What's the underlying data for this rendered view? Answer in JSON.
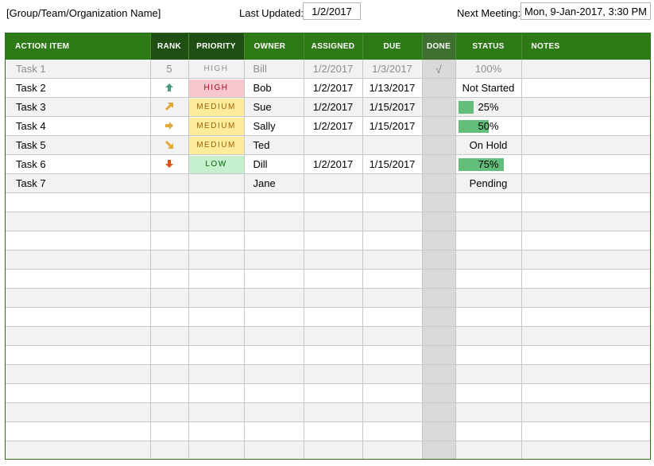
{
  "header": {
    "org_name": "[Group/Team/Organization Name]",
    "last_updated_label": "Last Updated:",
    "last_updated_value": "1/2/2017",
    "next_meeting_label": "Next Meeting:",
    "next_meeting_value": "Mon, 9-Jan-2017, 3:30 PM"
  },
  "columns": {
    "action": "ACTION ITEM",
    "rank": "RANK",
    "priority": "PRIORITY",
    "owner": "OWNER",
    "assigned": "ASSIGNED",
    "due": "DUE",
    "done": "DONE",
    "status": "STATUS",
    "notes": "NOTES"
  },
  "colors": {
    "header_green": "#2d7a16",
    "bar_green": "#63be7b",
    "high_bg": "#f8c7ce",
    "medium_bg": "#ffeb9c",
    "low_bg": "#c6efce"
  },
  "tasks": [
    {
      "item": "Task 1",
      "rank": "5",
      "priority": "HIGH",
      "priority_level": "plain",
      "owner": "Bill",
      "assigned": "1/2/2017",
      "due": "1/3/2017",
      "done": "√",
      "status": "100%",
      "progress": null,
      "completed": true,
      "rank_icon": ""
    },
    {
      "item": "Task 2",
      "rank": "",
      "priority": "HIGH",
      "priority_level": "high",
      "owner": "Bob",
      "assigned": "1/2/2017",
      "due": "1/13/2017",
      "done": "",
      "status": "Not Started",
      "progress": null,
      "completed": false,
      "rank_icon": "arrow-up-icon"
    },
    {
      "item": "Task 3",
      "rank": "",
      "priority": "MEDIUM",
      "priority_level": "medium",
      "owner": "Sue",
      "assigned": "1/2/2017",
      "due": "1/15/2017",
      "done": "",
      "status": "25%",
      "progress": 0.25,
      "completed": false,
      "rank_icon": "arrow-up-right-icon"
    },
    {
      "item": "Task 4",
      "rank": "",
      "priority": "MEDIUM",
      "priority_level": "medium",
      "owner": "Sally",
      "assigned": "1/2/2017",
      "due": "1/15/2017",
      "done": "",
      "status": "50%",
      "progress": 0.5,
      "completed": false,
      "rank_icon": "arrow-right-icon"
    },
    {
      "item": "Task 5",
      "rank": "",
      "priority": "MEDIUM",
      "priority_level": "medium",
      "owner": "Ted",
      "assigned": "",
      "due": "",
      "done": "",
      "status": "On Hold",
      "progress": null,
      "completed": false,
      "rank_icon": "arrow-down-right-icon"
    },
    {
      "item": "Task 6",
      "rank": "",
      "priority": "LOW",
      "priority_level": "low",
      "owner": "Dill",
      "assigned": "1/2/2017",
      "due": "1/15/2017",
      "done": "",
      "status": "75%",
      "progress": 0.75,
      "completed": false,
      "rank_icon": "arrow-down-icon"
    },
    {
      "item": "Task 7",
      "rank": "",
      "priority": "",
      "priority_level": "none",
      "owner": "Jane",
      "assigned": "",
      "due": "",
      "done": "",
      "status": "Pending",
      "progress": null,
      "completed": false,
      "rank_icon": ""
    }
  ]
}
